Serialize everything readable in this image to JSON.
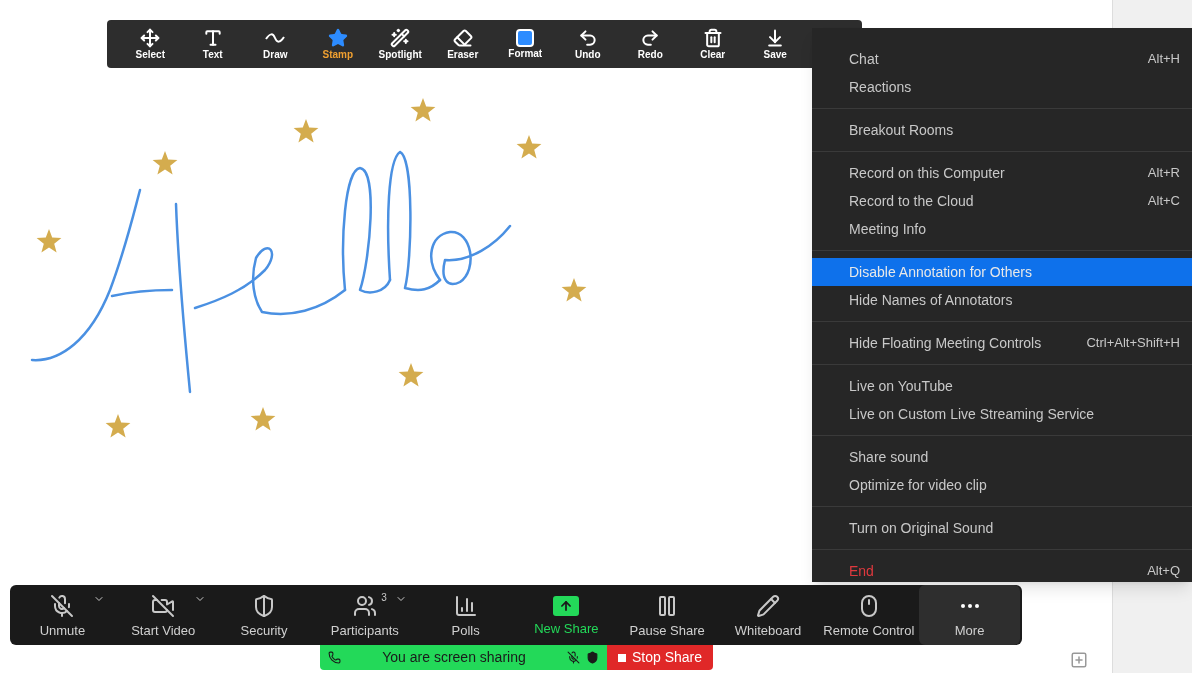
{
  "annotation_toolbar": {
    "tools": [
      {
        "kind": "select",
        "label": "Select",
        "selected": false
      },
      {
        "kind": "text",
        "label": "Text",
        "selected": false
      },
      {
        "kind": "draw",
        "label": "Draw",
        "selected": false
      },
      {
        "kind": "stamp",
        "label": "Stamp",
        "selected": true
      },
      {
        "kind": "spotlight",
        "label": "Spotlight",
        "selected": false
      },
      {
        "kind": "eraser",
        "label": "Eraser",
        "selected": false
      },
      {
        "kind": "format",
        "label": "Format",
        "selected": false
      },
      {
        "kind": "undo",
        "label": "Undo",
        "selected": false
      },
      {
        "kind": "redo",
        "label": "Redo",
        "selected": false
      },
      {
        "kind": "clear",
        "label": "Clear",
        "selected": false
      },
      {
        "kind": "save",
        "label": "Save",
        "selected": false
      }
    ]
  },
  "more_menu": {
    "sections": [
      [
        {
          "label": "Chat",
          "shortcut": "Alt+H",
          "selected": false,
          "kind": "normal"
        },
        {
          "label": "Reactions",
          "selected": false,
          "kind": "normal"
        }
      ],
      [
        {
          "label": "Breakout Rooms",
          "selected": false,
          "kind": "normal"
        }
      ],
      [
        {
          "label": "Record on this Computer",
          "shortcut": "Alt+R",
          "selected": false,
          "kind": "normal"
        },
        {
          "label": "Record to the Cloud",
          "shortcut": "Alt+C",
          "selected": false,
          "kind": "normal"
        },
        {
          "label": "Meeting Info",
          "selected": false,
          "kind": "normal"
        }
      ],
      [
        {
          "label": "Disable Annotation for Others",
          "selected": true,
          "kind": "normal"
        },
        {
          "label": "Hide Names of Annotators",
          "selected": false,
          "kind": "normal"
        }
      ],
      [
        {
          "label": "Hide Floating Meeting Controls",
          "shortcut": "Ctrl+Alt+Shift+H",
          "selected": false,
          "kind": "normal"
        }
      ],
      [
        {
          "label": "Live on YouTube",
          "selected": false,
          "kind": "normal"
        },
        {
          "label": "Live on Custom Live Streaming Service",
          "selected": false,
          "kind": "normal"
        }
      ],
      [
        {
          "label": "Share sound",
          "selected": false,
          "kind": "normal"
        },
        {
          "label": "Optimize for video clip",
          "selected": false,
          "kind": "normal"
        }
      ],
      [
        {
          "label": "Turn on Original Sound",
          "selected": false,
          "kind": "normal"
        }
      ],
      [
        {
          "label": "End",
          "shortcut": "Alt+Q",
          "selected": false,
          "kind": "danger"
        }
      ]
    ]
  },
  "meeting_controls": [
    {
      "kind": "mic",
      "label": "Unmute",
      "caret": true,
      "active": false
    },
    {
      "kind": "video",
      "label": "Start Video",
      "caret": true,
      "active": false
    },
    {
      "kind": "security",
      "label": "Security",
      "caret": false,
      "active": false
    },
    {
      "kind": "participants",
      "label": "Participants",
      "badge": "3",
      "caret": true,
      "active": false
    },
    {
      "kind": "polls",
      "label": "Polls",
      "caret": false,
      "active": false
    },
    {
      "kind": "share",
      "label": "New Share",
      "caret": false,
      "active": false
    },
    {
      "kind": "pause",
      "label": "Pause Share",
      "caret": false,
      "active": false
    },
    {
      "kind": "whiteboard",
      "label": "Whiteboard",
      "caret": false,
      "active": false
    },
    {
      "kind": "remote",
      "label": "Remote Control",
      "caret": false,
      "active": false
    },
    {
      "kind": "more",
      "label": "More",
      "caret": false,
      "active": true
    }
  ],
  "sharing_bar": {
    "status": "You are screen sharing",
    "stop_button": "Stop Share"
  }
}
